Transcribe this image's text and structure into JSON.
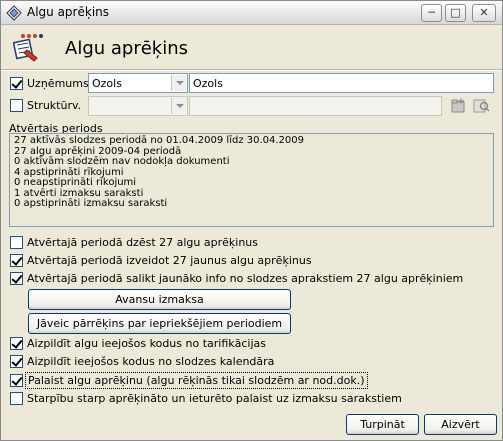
{
  "window": {
    "title": "Algu aprēķins"
  },
  "header": {
    "title": "Algu aprēķins"
  },
  "company": {
    "label": "Uzņēmums",
    "checked": true,
    "code": "Ozols",
    "name": "Ozols"
  },
  "structure": {
    "label": "Struktūrv.",
    "checked": false,
    "code": "",
    "name": ""
  },
  "period": {
    "label": "Atvērtais periods",
    "lines": [
      "27 aktīvās slodzes periodā no 01.04.2009 līdz 30.04.2009",
      "27 algu aprēķini 2009-04 periodā",
      "0 aktīvām slodzēm nav nodokļa dokumenti",
      "4 apstiprināti rīkojumi",
      "0 neapstiprināti rīkojumi",
      "1 atvērti izmaksu saraksti",
      "0 apstiprināti izmaksu saraksti"
    ]
  },
  "options": [
    {
      "label": "Atvērtajā periodā dzēst 27 algu aprēķinus",
      "checked": false
    },
    {
      "label": "Atvērtajā periodā izveidot 27 jaunus algu aprēķinus",
      "checked": true
    },
    {
      "label": "Atvērtajā periodā salikt jaunāko info no slodzes aprakstiem 27 algu aprēķiniem",
      "checked": true
    }
  ],
  "buttons": {
    "advance": "Avansu izmaksa",
    "recalc": "Jāveic pārrēķins par iepriekšējiem periodiem",
    "continue": "Turpināt",
    "close": "Aizvērt"
  },
  "options2": [
    {
      "label": "Aizpildīt algu ieejošos kodus no tarifikācijas",
      "checked": true
    },
    {
      "label": "Aizpildīt ieejošos kodus no slodzes kalendāra",
      "checked": true
    },
    {
      "label": "Palaist algu aprēķinu (algu rēķinās tikai slodzēm ar nod.dok.)",
      "checked": true
    },
    {
      "label": "Starpību starp aprēķināto un ieturēto palaist uz izmaksu sarakstiem",
      "checked": false
    }
  ]
}
